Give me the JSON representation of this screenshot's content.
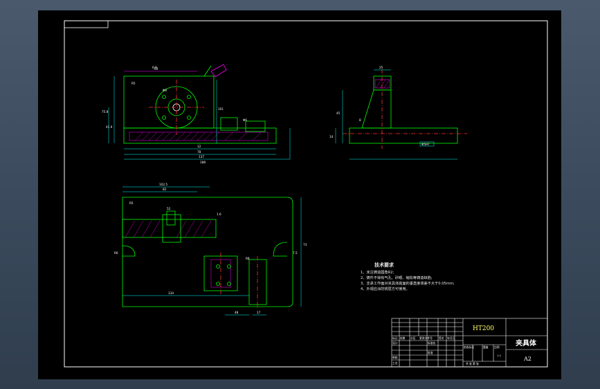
{
  "notes": {
    "title": "技术要求",
    "lines": [
      "1、未注铸造圆角R2;",
      "2、铸件不得有气孔、砂眼、缩松等铸造缺陷;",
      "3、支承工作面对夹具体底面的垂直度误差不大于0.05mm;",
      "4、外观应涂防锈层方可使用。"
    ]
  },
  "title_block": {
    "material": "HT200",
    "part_name": "夹具体",
    "sheet_size": "A2",
    "scale": "1:1",
    "labels": {
      "mark": "标记",
      "count": "处数",
      "zone": "分区",
      "change_doc": "更改文件号",
      "signature": "签名",
      "date": "年月日",
      "design": "设计",
      "standardize": "标准化",
      "review": "审核",
      "process": "工艺",
      "approve": "批准",
      "stage_mark": "阶段标记",
      "weight": "重量",
      "ratio": "比例",
      "sheets": "共  张   第  张"
    }
  },
  "dimensions": {
    "top_view": [
      "6-R",
      "R5",
      "60",
      "Φ8",
      "75.8",
      "101",
      "12",
      "78",
      "137",
      "188",
      "41.9",
      "Φ6"
    ],
    "side_view": [
      "25",
      "45",
      "8",
      "14",
      "Φ5H7"
    ],
    "bottom_view": [
      "102.5",
      "82",
      "52",
      "R5",
      "R6",
      "1.6",
      "134",
      "48",
      "17",
      "73",
      "7.5",
      "R8"
    ]
  }
}
